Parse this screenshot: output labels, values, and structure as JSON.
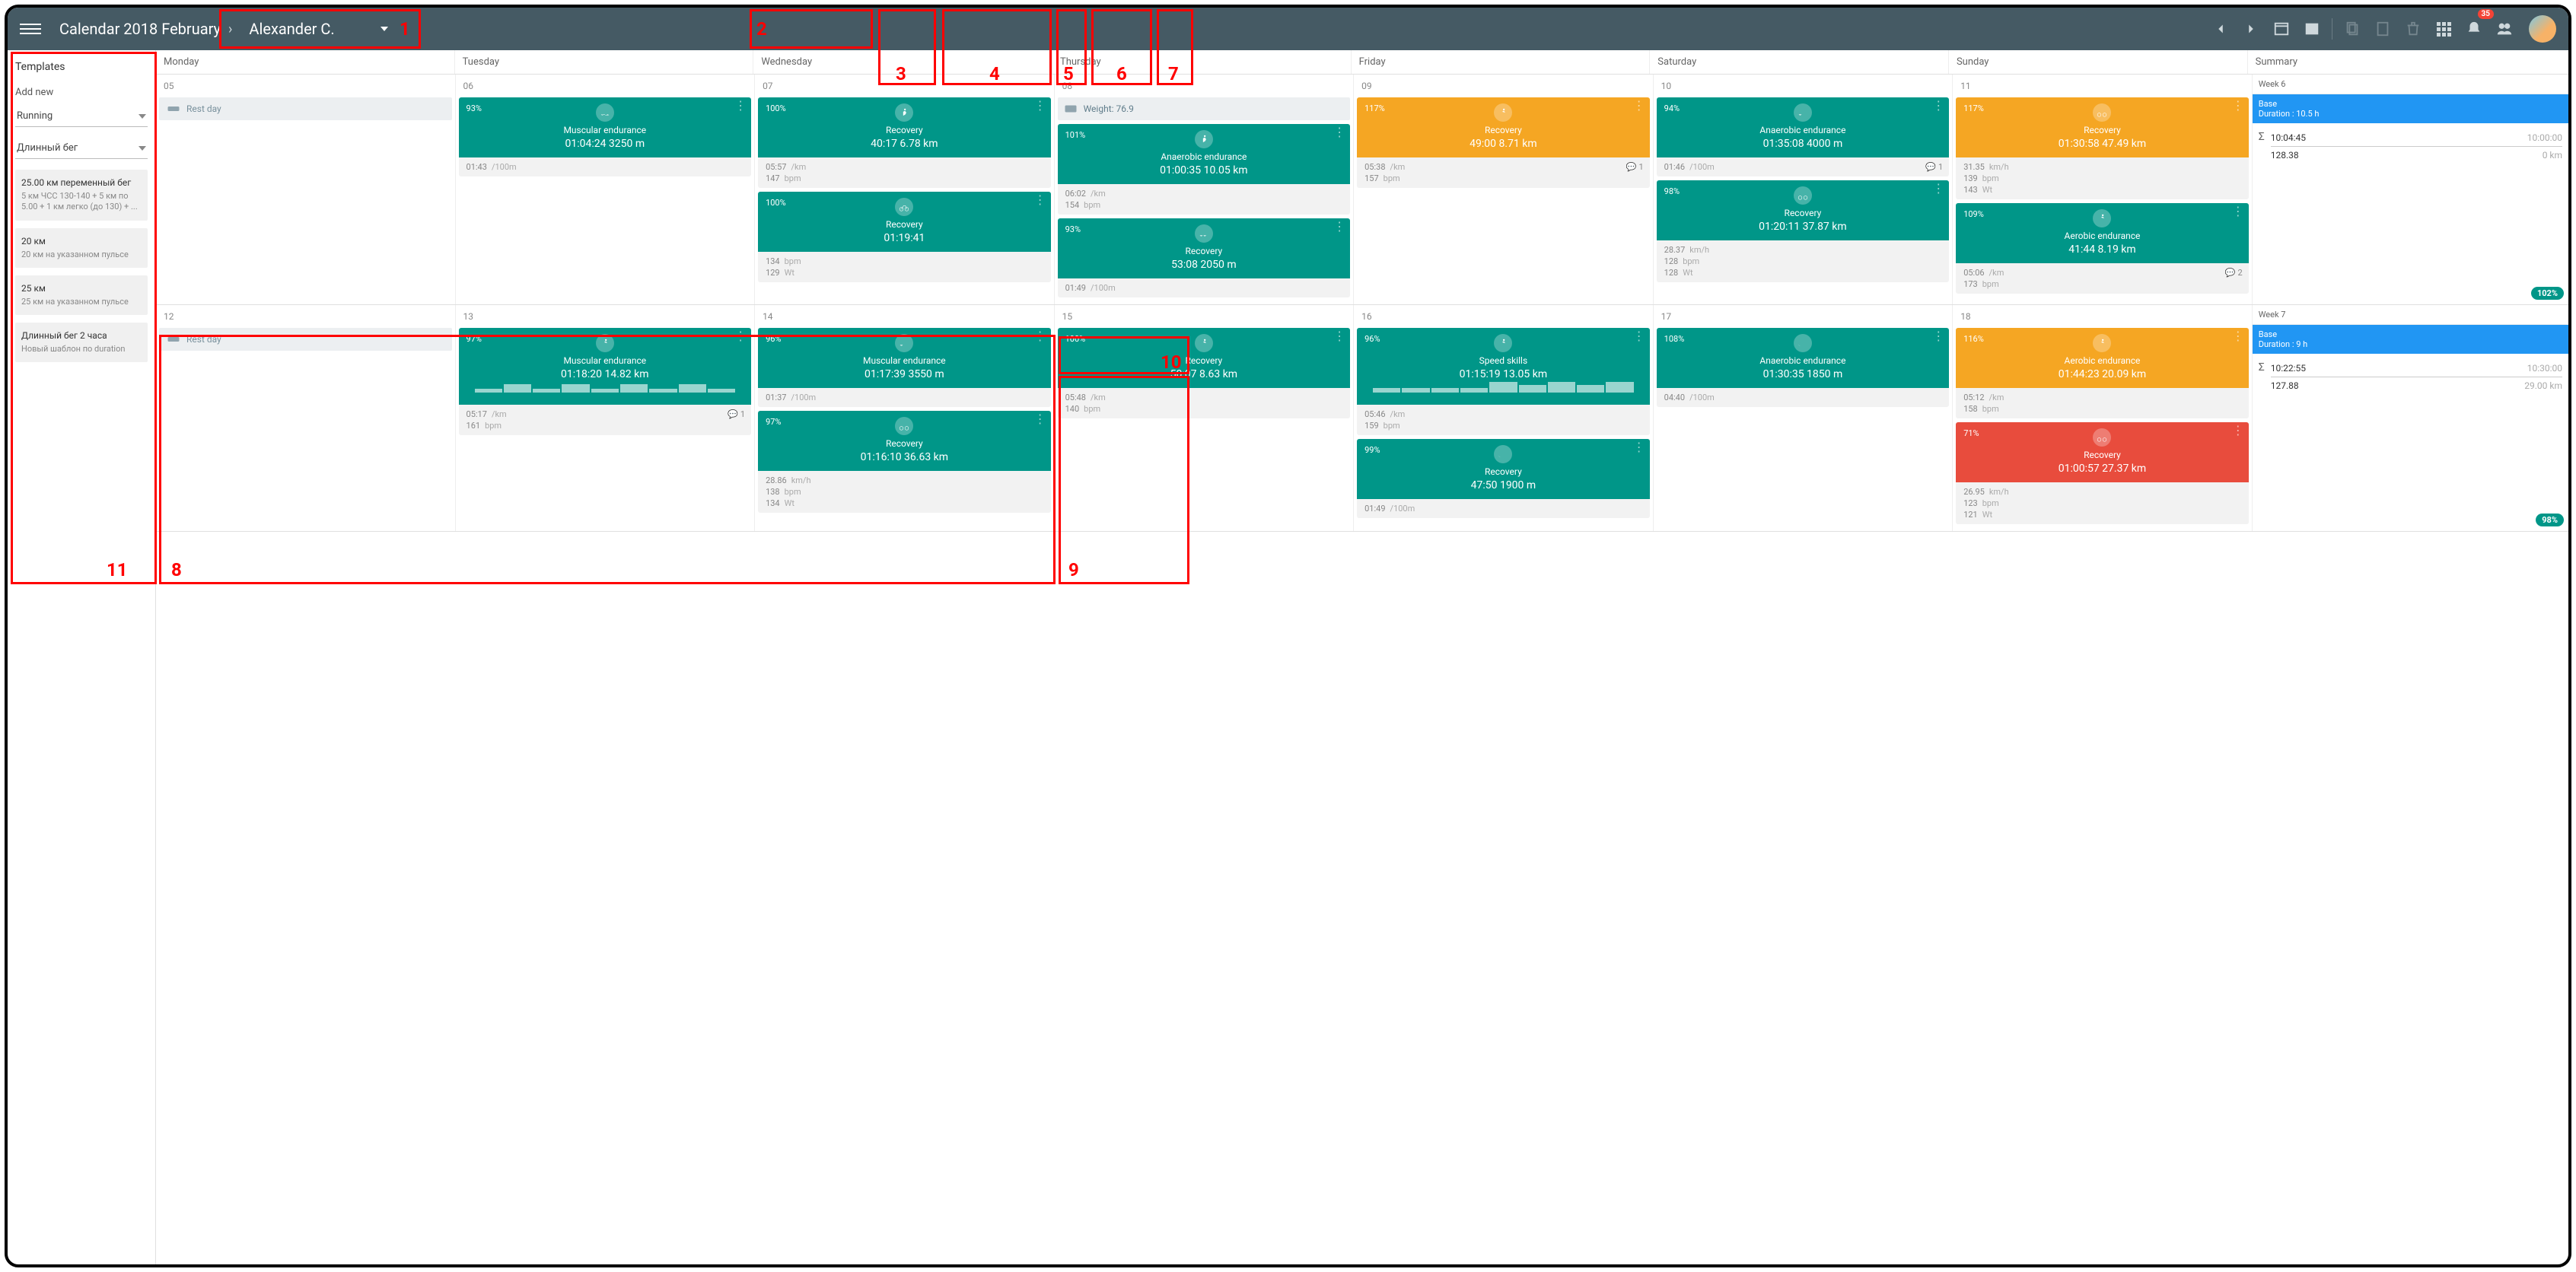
{
  "header": {
    "title": "Calendar 2018 February",
    "athlete": "Alexander C.",
    "notif_count": "35"
  },
  "sidebar": {
    "title": "Templates",
    "add_new": "Add new",
    "sel1": "Running",
    "sel2": "Длинный бег",
    "templates": [
      {
        "t": "25.00 км переменный бег",
        "d": "5 км ЧСС 130-140 + 5 км по 5.00 + 1 км легко (до 130) + ..."
      },
      {
        "t": "20 км",
        "d": "20 км на указанном пульсе"
      },
      {
        "t": "25 км",
        "d": "25 км на указанном пульсе"
      },
      {
        "t": "Длинный бег 2 часа",
        "d": "Новый шаблон по duration"
      }
    ]
  },
  "days": [
    "Monday",
    "Tuesday",
    "Wednesday",
    "Thursday",
    "Friday",
    "Saturday",
    "Sunday",
    "Summary"
  ],
  "week1": {
    "label": "Week 6",
    "base": "Base",
    "dur": "Duration :  10.5 h",
    "sum": {
      "t1": "10:04:45",
      "t2": "10:00:00",
      "d1": "128.38",
      "d2": "0 km"
    },
    "pill": "102%",
    "dates": [
      "05",
      "06",
      "07",
      "08",
      "09",
      "10",
      "11"
    ],
    "rest": "Rest day",
    "weight": "Weight: 76.9",
    "c_06_1": {
      "pct": "93%",
      "title": "Muscular endurance",
      "m": "01:04:24  3250 m",
      "f1": "01:43",
      "f1l": "/100m"
    },
    "c_07_1": {
      "pct": "100%",
      "title": "Recovery",
      "m": "40:17  6.78 km",
      "f1": "05:57",
      "f1l": "/km",
      "f2": "147",
      "f2l": "bpm"
    },
    "c_07_2": {
      "pct": "100%",
      "title": "Recovery",
      "m": "01:19:41",
      "f1": "134",
      "f1l": "bpm",
      "f2": "129",
      "f2l": "Wt"
    },
    "c_08_1": {
      "pct": "101%",
      "title": "Anaerobic endurance",
      "m": "01:00:35  10.05 km",
      "f1": "06:02",
      "f1l": "/km",
      "f2": "154",
      "f2l": "bpm"
    },
    "c_08_2": {
      "pct": "93%",
      "title": "Recovery",
      "m": "53:08  2050 m",
      "f1": "01:49",
      "f1l": "/100m"
    },
    "c_09_1": {
      "pct": "117%",
      "title": "Recovery",
      "m": "49:00  8.71 km",
      "f1": "05:38",
      "f1l": "/km",
      "f2": "157",
      "f2l": "bpm",
      "cmt": "1"
    },
    "c_10_1": {
      "pct": "94%",
      "title": "Anaerobic endurance",
      "m": "01:35:08  4000 m",
      "f1": "01:46",
      "f1l": "/100m",
      "cmt": "1"
    },
    "c_10_2": {
      "pct": "98%",
      "title": "Recovery",
      "m": "01:20:11  37.87 km",
      "f1": "28.37",
      "f1l": "km/h",
      "f2": "128",
      "f2l": "bpm",
      "f3": "128",
      "f3l": "Wt"
    },
    "c_11_1": {
      "pct": "117%",
      "title": "Recovery",
      "m": "01:30:58  47.49 km",
      "f1": "31.35",
      "f1l": "km/h",
      "f2": "139",
      "f2l": "bpm",
      "f3": "143",
      "f3l": "Wt"
    },
    "c_11_2": {
      "pct": "109%",
      "title": "Aerobic endurance",
      "m": "41:44  8.19 km",
      "f1": "05:06",
      "f1l": "/km",
      "f2": "173",
      "f2l": "bpm",
      "cmt": "2"
    }
  },
  "week2": {
    "label": "Week 7",
    "base": "Base",
    "dur": "Duration :  9 h",
    "sum": {
      "t1": "10:22:55",
      "t2": "10:30:00",
      "d1": "127.88",
      "d2": "29.00 km"
    },
    "pill": "98%",
    "dates": [
      "12",
      "13",
      "14",
      "15",
      "16",
      "17",
      "18"
    ],
    "rest": "Rest day",
    "c_13_1": {
      "pct": "97%",
      "title": "Muscular endurance",
      "m": "01:18:20  14.82 km",
      "f1": "05:17",
      "f1l": "/km",
      "f2": "161",
      "f2l": "bpm",
      "cmt": "1"
    },
    "c_14_1": {
      "pct": "96%",
      "title": "Muscular endurance",
      "m": "01:17:39  3550 m",
      "f1": "01:37",
      "f1l": "/100m"
    },
    "c_14_2": {
      "pct": "97%",
      "title": "Recovery",
      "m": "01:16:10  36.63 km",
      "f1": "28.86",
      "f1l": "km/h",
      "f2": "138",
      "f2l": "bpm",
      "f3": "134",
      "f3l": "Wt"
    },
    "c_15_1": {
      "pct": "100%",
      "title": "Recovery",
      "m": "50:07  8.63 km",
      "f1": "05:48",
      "f1l": "/km",
      "f2": "140",
      "f2l": "bpm"
    },
    "c_16_1": {
      "pct": "96%",
      "title": "Speed skills",
      "m": "01:15:19  13.05 km",
      "f1": "05:46",
      "f1l": "/km",
      "f2": "159",
      "f2l": "bpm"
    },
    "c_16_2": {
      "pct": "99%",
      "title": "Recovery",
      "m": "47:50  1900 m",
      "f1": "01:49",
      "f1l": "/100m"
    },
    "c_17_1": {
      "pct": "108%",
      "title": "Anaerobic endurance",
      "m": "01:30:35  1850 m",
      "f1": "04:40",
      "f1l": "/100m"
    },
    "c_18_1": {
      "pct": "116%",
      "title": "Aerobic endurance",
      "m": "01:44:23  20.09 km",
      "f1": "05:12",
      "f1l": "/km",
      "f2": "158",
      "f2l": "bpm"
    },
    "c_18_2": {
      "pct": "71%",
      "title": "Recovery",
      "m": "01:00:57  27.37 km",
      "f1": "26.95",
      "f1l": "km/h",
      "f2": "123",
      "f2l": "bpm",
      "f3": "121",
      "f3l": "Wt"
    }
  },
  "ann": {
    "1": "1",
    "2": "2",
    "3": "3",
    "4": "4",
    "5": "5",
    "6": "6",
    "7": "7",
    "8": "8",
    "9": "9",
    "10": "10",
    "11": "11"
  }
}
